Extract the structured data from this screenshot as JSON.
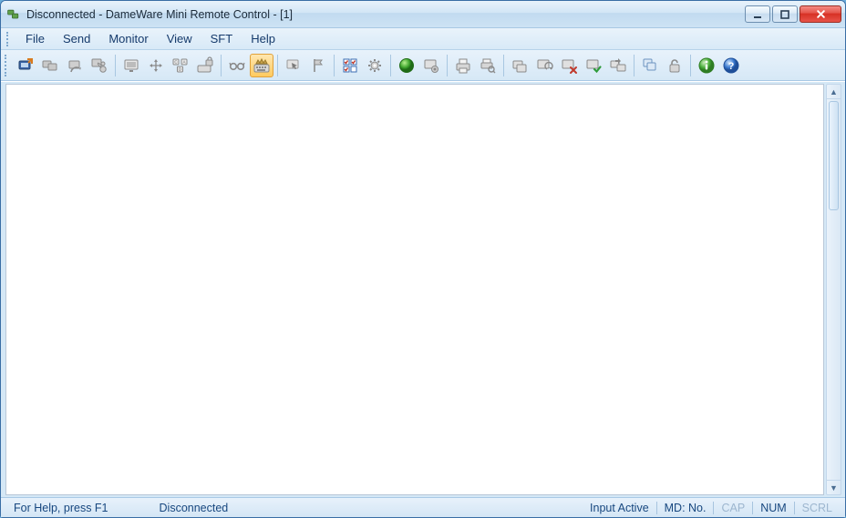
{
  "title": "Disconnected - DameWare Mini Remote Control - [1]",
  "menu": {
    "file": "File",
    "send": "Send",
    "monitor": "Monitor",
    "view": "View",
    "sft": "SFT",
    "help": "Help"
  },
  "toolbar_icons": {
    "connect": "connect-icon",
    "disconnect": "disconnect-icon",
    "reconnect": "reconnect-icon",
    "share": "share-icon",
    "show_remote_cursor": "remote-cursor-icon",
    "full_screen": "fullscreen-move-icon",
    "send_cad": "ctrl-alt-del-icon",
    "lock_keyboard": "lock-keyboard-icon",
    "view_only": "glasses-icon",
    "notepad": "keyboard-crown-icon",
    "remote_pointer": "pointer-icon",
    "wake": "flag-icon",
    "arrange": "grid-checks-icon",
    "settings": "gear-icon",
    "ping": "green-orb-icon",
    "screenshot": "camera-icon",
    "print": "printer-icon",
    "print_preview": "print-search-icon",
    "copy_screen": "copy-screen-icon",
    "refresh_screen": "refresh-screen-icon",
    "end_session": "screen-x-icon",
    "approve_session": "screen-check-icon",
    "transfer": "transfer-icon",
    "cascade": "cascade-icon",
    "unlock": "unlock-icon",
    "about": "info-icon",
    "help": "help-icon"
  },
  "status": {
    "help_hint": "For Help, press F1",
    "connection": "Disconnected",
    "input": "Input Active",
    "md": "MD: No.",
    "cap": "CAP",
    "num": "NUM",
    "scrl": "SCRL"
  },
  "colors": {
    "accent": "#17477f",
    "close_red": "#d62f23",
    "info_green": "#3aa53a",
    "help_blue": "#2a6fd1"
  }
}
